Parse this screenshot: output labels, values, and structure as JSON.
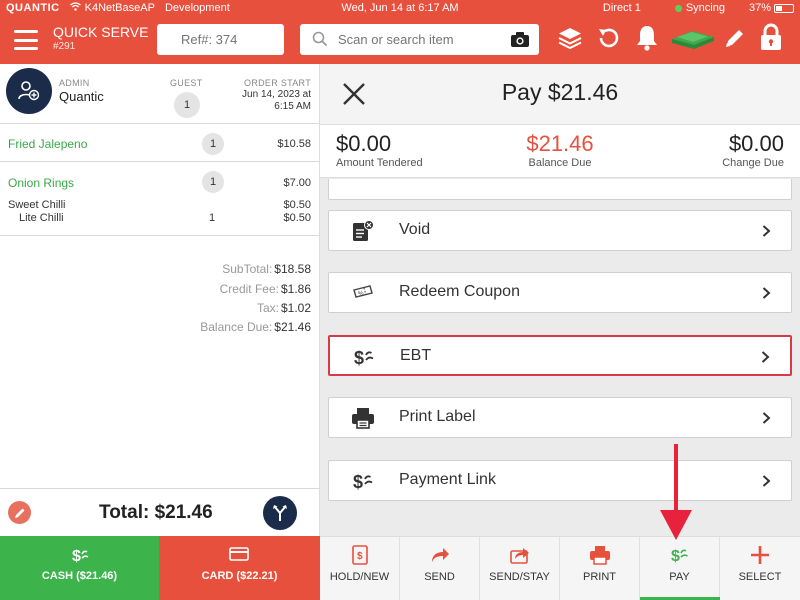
{
  "status_bar": {
    "brand": "QUANTIC",
    "wifi_network": "K4NetBaseAP",
    "environment": "Development",
    "datetime": "Wed, Jun 14 at 6:17 AM",
    "device": "Direct 1",
    "sync_status": "Syncing",
    "battery": "37%",
    "battery_level": 0.37
  },
  "header": {
    "app_title": "QUICK SERVE",
    "order_number": "#291",
    "ref_placeholder": "Ref#: 374",
    "search_placeholder": "Scan or search item"
  },
  "order": {
    "admin_label": "ADMIN",
    "admin_name": "Quantic",
    "guest_label": "GUEST",
    "guest_count": "1",
    "order_start_label": "ORDER START",
    "order_start_line1": "Jun 14, 2023 at",
    "order_start_line2": "6:15 AM",
    "items": [
      {
        "name": "Fried Jalepeno",
        "qty": "1",
        "price": "$10.58"
      },
      {
        "name": "Onion Rings",
        "qty": "1",
        "price": "$7.00"
      }
    ],
    "modifiers": [
      {
        "name": "Sweet Chilli",
        "qty": "",
        "price": "$0.50"
      },
      {
        "name": "Lite Chilli",
        "qty": "1",
        "price": "$0.50"
      }
    ],
    "summary": [
      {
        "label": "SubTotal:",
        "value": "$18.58"
      },
      {
        "label": "Credit Fee:",
        "value": "$1.86"
      },
      {
        "label": "Tax:",
        "value": "$1.02"
      },
      {
        "label": "Balance Due:",
        "value": "$21.46"
      }
    ],
    "total": "Total: $21.46"
  },
  "pay_buttons": {
    "cash": "CASH ($21.46)",
    "card": "CARD ($22.21)"
  },
  "payment": {
    "title": "Pay $21.46",
    "amount_tendered_value": "$0.00",
    "amount_tendered_label": "Amount Tendered",
    "balance_due_value": "$21.46",
    "balance_due_label": "Balance Due",
    "change_due_value": "$0.00",
    "change_due_label": "Change Due",
    "options": [
      {
        "label": "Void",
        "icon": "void-receipt-icon"
      },
      {
        "label": "Redeem Coupon",
        "icon": "coupon-icon"
      },
      {
        "label": "EBT",
        "icon": "dollar-icon",
        "selected": true
      },
      {
        "label": "Print Label",
        "icon": "printer-icon"
      },
      {
        "label": "Payment Link",
        "icon": "dollar-icon"
      }
    ]
  },
  "toolbar": {
    "hold_new": "HOLD/NEW",
    "send": "SEND",
    "send_stay": "SEND/STAY",
    "print": "PRINT",
    "pay": "PAY",
    "select": "SELECT"
  },
  "colors": {
    "brand_red": "#e8503e",
    "cash_green": "#3cb44b",
    "navy": "#1a2c4a",
    "highlight_border": "#d93a4a"
  }
}
